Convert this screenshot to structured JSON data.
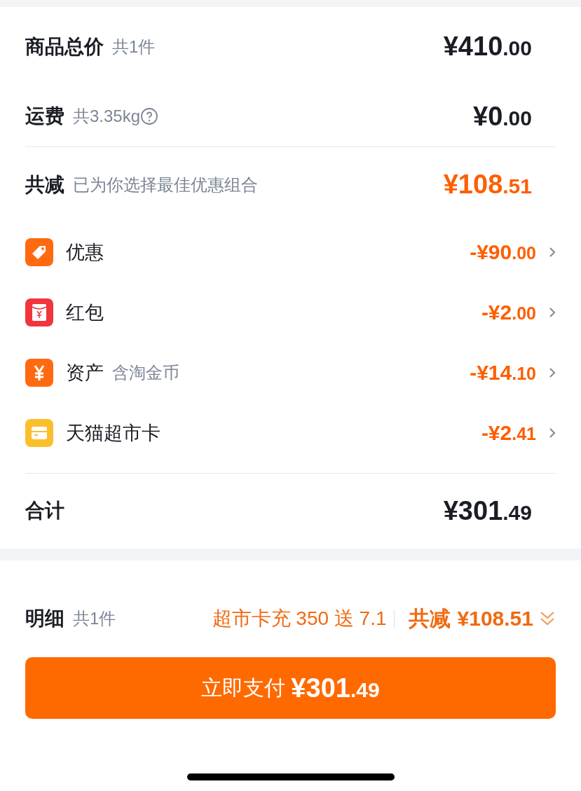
{
  "summary": {
    "subtotal": {
      "label": "商品总价",
      "note": "共1件",
      "amount": "¥410.00"
    },
    "shipping": {
      "label": "运费",
      "note": "共3.35kg",
      "amount": "¥0.00"
    },
    "discount": {
      "label": "共减",
      "note": "已为你选择最佳优惠组合",
      "amount": "¥108.51"
    },
    "items": [
      {
        "kind": "coupon",
        "label": "优惠",
        "amount": "-¥90.00"
      },
      {
        "kind": "red_packet",
        "label": "红包",
        "amount": "-¥2.00"
      },
      {
        "kind": "assets",
        "label": "资产",
        "note": "含淘金币",
        "amount": "-¥14.10"
      },
      {
        "kind": "card",
        "label": "天猫超市卡",
        "amount": "-¥2.41"
      }
    ],
    "total": {
      "label": "合计",
      "amount": "¥301.49"
    }
  },
  "footer": {
    "label": "明细",
    "note": "共1件",
    "promo": "超市卡充 350 送 7.1",
    "saving_label": "共减",
    "saving": "¥108.51",
    "pay_button": {
      "label": "立即支付",
      "amount": "¥301.49"
    }
  }
}
